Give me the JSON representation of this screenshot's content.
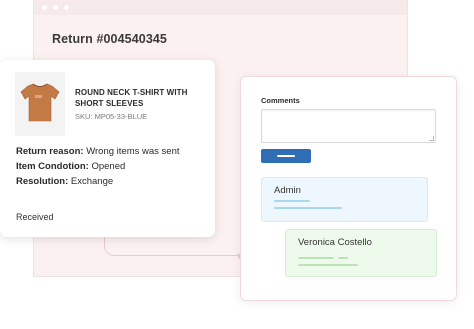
{
  "return": {
    "title": "Return #004540345"
  },
  "product": {
    "name": "ROUND NECK T-SHIRT WITH SHORT SLEEVES",
    "sku": "SKU: MP05-33-BLUE",
    "image_icon": "tshirt-icon",
    "image_color": "#c47a45"
  },
  "details": {
    "reason_label": "Return reason:",
    "reason_value": "Wrong items was sent",
    "condition_label": "Item Condotion:",
    "condition_value": "Opened",
    "resolution_label": "Resolution:",
    "resolution_value": "Exchange"
  },
  "status": "Received",
  "comments": {
    "label": "Comments",
    "input_value": "",
    "submit_color": "#2f6db5",
    "items": [
      {
        "author": "Admin",
        "bg": "#eef7fd"
      },
      {
        "author": "Veronica Costello",
        "bg": "#eefbec"
      }
    ]
  },
  "colors": {
    "window_bg": "#fcf1f1",
    "accent": "#2f6db5"
  }
}
